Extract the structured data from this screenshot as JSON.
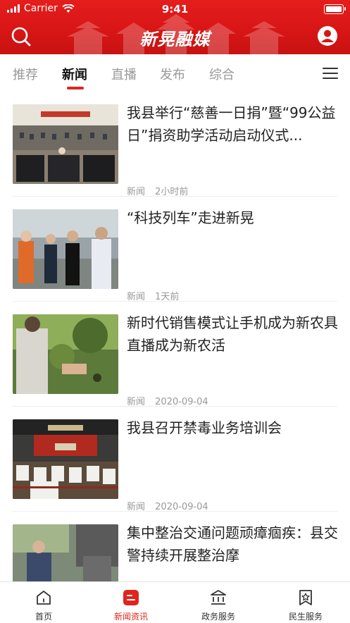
{
  "status_bar": {
    "carrier": "Carrier",
    "time": "9:41"
  },
  "header": {
    "logo_text": "新晃融媒",
    "search_icon": "search-icon",
    "user_icon": "user-icon",
    "brand_color": "#d71515"
  },
  "tabs": [
    {
      "label": "推荐",
      "active": false
    },
    {
      "label": "新闻",
      "active": true
    },
    {
      "label": "直播",
      "active": false
    },
    {
      "label": "发布",
      "active": false
    },
    {
      "label": "综合",
      "active": false
    }
  ],
  "menu_icon": "menu-icon",
  "news": [
    {
      "title": "我县举行“慈善一日捐”暨“99公益日”捐资助学活动启动仪式...",
      "category": "新闻",
      "time": "2小时前"
    },
    {
      "title": "“科技列车”走进新晃",
      "category": "新闻",
      "time": "1天前"
    },
    {
      "title": "新时代销售模式让手机成为新农具 直播成为新农活",
      "category": "新闻",
      "time": "2020-09-04"
    },
    {
      "title": "我县召开禁毒业务培训会",
      "category": "新闻",
      "time": "2020-09-04"
    },
    {
      "title": "集中整治交通问题顽瘴痼疾：县交警持续开展整治摩",
      "category": "",
      "time": ""
    }
  ],
  "bottom_nav": [
    {
      "label": "首页",
      "icon": "home-icon",
      "active": false
    },
    {
      "label": "新闻资讯",
      "icon": "news-icon",
      "active": true
    },
    {
      "label": "政务服务",
      "icon": "government-icon",
      "active": false
    },
    {
      "label": "民生服务",
      "icon": "badge-icon",
      "active": false
    }
  ],
  "accent_color": "#e0251f"
}
